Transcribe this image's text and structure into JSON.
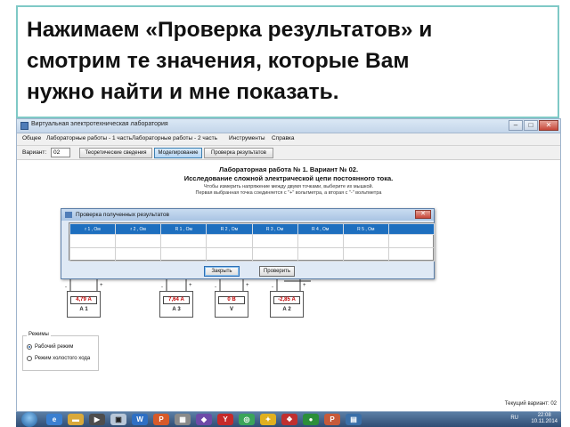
{
  "caption": {
    "line1": "Нажимаем «Проверка результатов» и",
    "line2": "смотрим те значения, которые Вам",
    "line3": "нужно найти и мне показать."
  },
  "window": {
    "title": "Виртуальная электротехническая лаборатория",
    "buttons": {
      "minimize": "–",
      "maximize": "□",
      "close": "✕"
    }
  },
  "menu": [
    "Общее",
    "Лабораторные работы - 1 часть",
    "Лабораторные работы - 2 часть",
    "Инструменты",
    "Справка"
  ],
  "toolbar": {
    "variant_label": "Вариант:",
    "variant_value": "02",
    "tabs": [
      "Теоретические сведения",
      "Моделирование",
      "Проверка результатов"
    ]
  },
  "lab": {
    "title": "Лабораторная работа № 1. Вариант № 02.",
    "subtitle": "Исследование сложной электрической цепи постоянного тока.",
    "hint1": "Чтобы измерить напряжение между двумя точками, выберите их мышкой.",
    "hint2": "Первая выбранная точка соединяется с \"+\" вольтметра, а вторая с \"-\" вольтметра"
  },
  "meters": [
    {
      "value": "4,79 А",
      "unit": "А 1"
    },
    {
      "value": "7,64 А",
      "unit": "А 3"
    },
    {
      "value": "0 В",
      "unit": "V"
    },
    {
      "value": "-2,85 А",
      "unit": "А 2"
    }
  ],
  "modes": {
    "legend": "Режимы",
    "options": [
      "Рабочий режим",
      "Режим холостого хода"
    ],
    "selected": 0
  },
  "current_variant": "Текущий вариант: 02",
  "dialog": {
    "title": "Проверка полученных результатов",
    "headers": [
      "r 1 , Ом",
      "r 2 , Ом",
      "R 1 , Ом",
      "R 2 , Ом",
      "R 3 , Ом",
      "R 4 , Ом",
      "R 5 , Ом",
      ""
    ],
    "close_label": "Закрыть",
    "check_label": "Проверить"
  },
  "taskbar": {
    "time": "22:08",
    "date": "10.11.2014",
    "lang": "RU"
  },
  "colors": {
    "accent": "#1e6fbf",
    "meter_value": "#c00000",
    "caption_border": "#7fc9c6"
  }
}
